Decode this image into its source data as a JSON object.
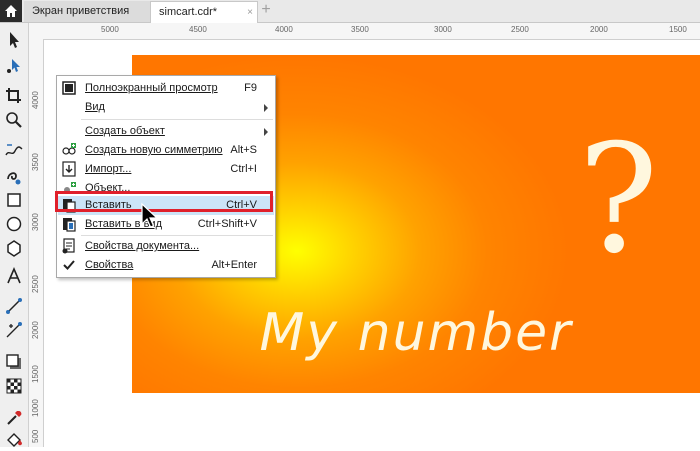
{
  "tabs": {
    "home_icon": "home-icon",
    "items": [
      {
        "label": "Экран приветствия",
        "close": "×"
      },
      {
        "label": "simcart.cdr*",
        "close": "×"
      }
    ],
    "add_label": "+"
  },
  "toolbox": {
    "tools": [
      "pick-tool-icon",
      "shape-tool-icon",
      "crop-tool-icon",
      "zoom-tool-icon",
      "freehand-tool-icon",
      "artistic-media-icon",
      "rectangle-tool-icon",
      "ellipse-tool-icon",
      "polygon-tool-icon",
      "text-tool-icon",
      "connector-tool-icon",
      "blend-tool-icon",
      "drop-shadow-icon",
      "transparency-tool-icon",
      "eyedropper-icon",
      "fill-tool-icon"
    ]
  },
  "rulers": {
    "top_ticks": [
      "5000",
      "4500",
      "4000",
      "3500",
      "3000",
      "2500",
      "2000",
      "1500"
    ],
    "left_ticks": [
      "4000",
      "3500",
      "3000",
      "2500",
      "2000",
      "1500",
      "1000",
      "500"
    ]
  },
  "artwork": {
    "question_mark": "?",
    "title": "My number",
    "colors": {
      "center": "#ffff00",
      "outer": "#ff7600",
      "text": "#fff7de"
    }
  },
  "context_menu": {
    "items": [
      {
        "label": "Полноэкранный просмотр",
        "shortcut": "F9",
        "icon": "fullscreen-icon"
      },
      {
        "label": "Вид",
        "shortcut": "",
        "submenu": true
      },
      {
        "label": "Создать объект",
        "shortcut": "",
        "submenu": true
      },
      {
        "label": "Создать новую симметрию",
        "shortcut": "Alt+S",
        "icon": "symmetry-icon"
      },
      {
        "label": "Импорт...",
        "shortcut": "Ctrl+I",
        "icon": "import-icon"
      },
      {
        "label": "Объект...",
        "shortcut": "",
        "icon": "object-icon"
      },
      {
        "label": "Вставить",
        "shortcut": "Ctrl+V",
        "icon": "paste-icon",
        "highlighted": true
      },
      {
        "label": "Вставить в вид",
        "shortcut": "Ctrl+Shift+V",
        "icon": "paste-in-view-icon"
      },
      {
        "label": "Свойства документа...",
        "shortcut": "",
        "icon": "document-properties-icon"
      },
      {
        "label": "Свойства",
        "shortcut": "Alt+Enter",
        "icon": "checkmark-icon"
      }
    ],
    "highlight_color": "#e0202b"
  }
}
